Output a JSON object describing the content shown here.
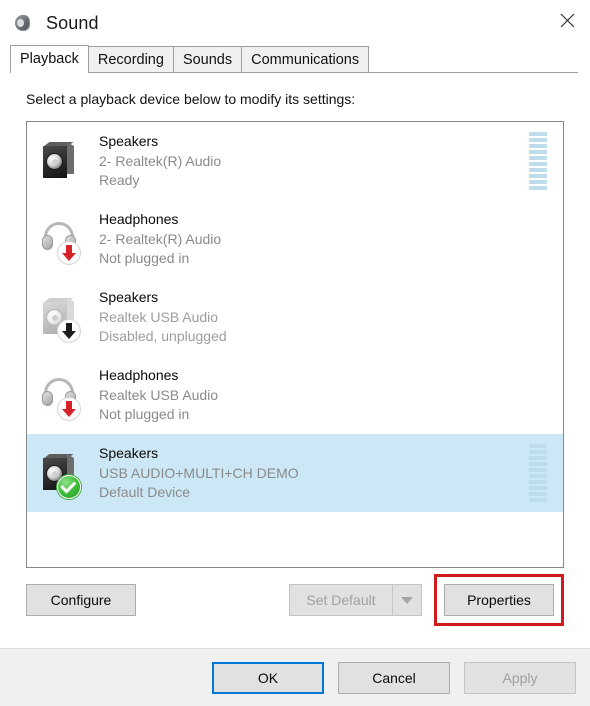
{
  "window": {
    "title": "Sound",
    "icon": "speaker-icon",
    "close_label": "✕"
  },
  "tabs": [
    {
      "label": "Playback",
      "active": true
    },
    {
      "label": "Recording",
      "active": false
    },
    {
      "label": "Sounds",
      "active": false
    },
    {
      "label": "Communications",
      "active": false
    }
  ],
  "panel": {
    "hint": "Select a playback device below to modify its settings:"
  },
  "devices": [
    {
      "name": "Speakers",
      "driver": "2- Realtek(R) Audio",
      "status": "Ready",
      "icon": "speaker-icon",
      "badge": "none",
      "selected": false,
      "meter": true,
      "meter_segments": 10
    },
    {
      "name": "Headphones",
      "driver": "2- Realtek(R) Audio",
      "status": "Not plugged in",
      "icon": "headphones-icon",
      "badge": "red-down-arrow",
      "selected": false,
      "meter": false,
      "meter_segments": 0
    },
    {
      "name": "Speakers",
      "driver": "Realtek USB Audio",
      "status": "Disabled, unplugged",
      "icon": "speaker-disabled-icon",
      "badge": "dark-down-arrow",
      "selected": false,
      "meter": false,
      "meter_segments": 0
    },
    {
      "name": "Headphones",
      "driver": "Realtek USB Audio",
      "status": "Not plugged in",
      "icon": "headphones-icon",
      "badge": "red-down-arrow",
      "selected": false,
      "meter": false,
      "meter_segments": 0
    },
    {
      "name": "Speakers",
      "driver": "USB AUDIO+MULTI+CH DEMO",
      "status": "Default Device",
      "icon": "speaker-icon",
      "badge": "green-check",
      "selected": true,
      "meter": true,
      "meter_segments": 10
    }
  ],
  "actions": {
    "configure": "Configure",
    "set_default": "Set Default",
    "set_default_dropdown": "set-default-dropdown-icon",
    "properties": "Properties"
  },
  "footer": {
    "ok": "OK",
    "cancel": "Cancel",
    "apply": "Apply"
  },
  "colors": {
    "selection": "#cce8f6",
    "highlight_box": "#cf1b1b",
    "default_focus": "#0078d7",
    "meter_segment": "#bfdcea",
    "status_red": "#d6232a",
    "status_green": "#2cae2c"
  }
}
